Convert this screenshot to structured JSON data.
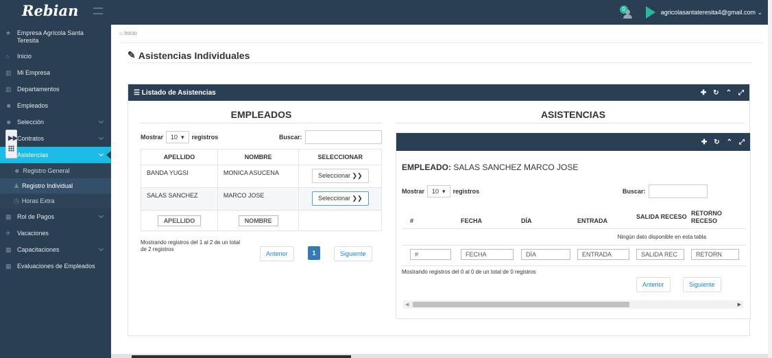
{
  "brand": {
    "logo_text": "Rebian"
  },
  "topbar": {
    "notification_count": "0",
    "user_email": "agricolasantateresita4@gmail.com ⌄"
  },
  "sidebar": {
    "company": "Empresa Agrícola Santa Teresita",
    "items": [
      {
        "label": "Inicio",
        "icon": "home-icon"
      },
      {
        "label": "Mi Empresa",
        "icon": "bank-icon"
      },
      {
        "label": "Departamentos",
        "icon": "bank-icon"
      },
      {
        "label": "Empleados",
        "icon": "users-icon"
      },
      {
        "label": "Selección",
        "icon": "users-icon"
      },
      {
        "label": "Contratos",
        "icon": "file-icon"
      },
      {
        "label": "Asistencias",
        "icon": "edit-icon"
      },
      {
        "label": "Rol de Pagos",
        "icon": "table-icon"
      },
      {
        "label": "Vacaciones",
        "icon": "plane-icon"
      },
      {
        "label": "Capacitaciones",
        "icon": "table-icon"
      },
      {
        "label": "Evaluaciones de Empleados",
        "icon": "table-icon"
      }
    ],
    "subitems": [
      {
        "label": "Registro General",
        "icon": "users-icon"
      },
      {
        "label": "Registro Individual",
        "icon": "user-icon"
      },
      {
        "label": "Horas Extra",
        "icon": "clock-icon"
      }
    ]
  },
  "breadcrumb": "Inicio",
  "page_title": "Asistencias Individuales",
  "panel": {
    "title": "Listado de Asistencias",
    "tools": [
      "✚",
      "↻",
      "⌃",
      "⤢"
    ]
  },
  "empleados": {
    "title": "EMPLEADOS",
    "show_label": "Mostrar",
    "page_size": "10",
    "records_label": "registros",
    "search_label": "Buscar:",
    "columns": [
      "APELLIDO",
      "NOMBRE",
      "SELECCIONAR"
    ],
    "rows": [
      {
        "apellido": "BANDA YUGSI",
        "nombre": "MONICA ASUCENA",
        "action": "Seleccionar ❯❯"
      },
      {
        "apellido": "SALAS SANCHEZ",
        "nombre": "MARCO JOSE",
        "action": "Seleccionar ❯❯"
      }
    ],
    "footer_filters": [
      "APELLIDO",
      "NOMBRE"
    ],
    "info": "Mostrando registros del 1 al 2 de un total de 2 registros",
    "prev": "Anterior",
    "page": "1",
    "next": "Siguiente"
  },
  "asistencias": {
    "title": "ASISTENCIAS",
    "employee_label": "EMPLEADO:",
    "employee_name": "SALAS SANCHEZ MARCO JOSE",
    "show_label": "Mostrar",
    "page_size": "10",
    "records_label": "registros",
    "search_label": "Buscar:",
    "columns": [
      "#",
      "FECHA",
      "DÍA",
      "ENTRADA",
      "SALIDA RECESO",
      "RETORNO RECESO"
    ],
    "empty_message": "Ningún dato disponible en esta tabla",
    "footer_filters": [
      "#",
      "FECHA",
      "DÍA",
      "ENTRADA",
      "SALIDA REC",
      "RETORN"
    ],
    "info": "Mostrando registros del 0 al 0 de un total de 0 registros",
    "prev": "Anterior",
    "next": "Siguiente"
  }
}
